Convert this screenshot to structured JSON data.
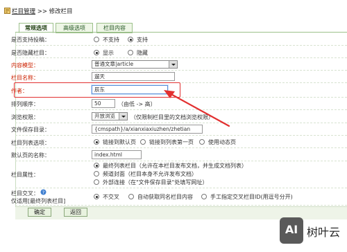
{
  "breadcrumb": {
    "link": "栏目管理",
    "separator": " >> ",
    "current": "修改栏目"
  },
  "tabs": [
    {
      "label": "常规选项"
    },
    {
      "label": "高级选项"
    },
    {
      "label": "栏目内容"
    }
  ],
  "form": {
    "support_submit": {
      "label": "是否支持投稿：",
      "options": [
        "不支持",
        "支持"
      ],
      "selected": "支持"
    },
    "hidden": {
      "label": "是否隐藏栏目：",
      "options": [
        "显示",
        "隐藏"
      ],
      "selected": "显示"
    },
    "content_model": {
      "label": "内容模型：",
      "value": "普通文章|article"
    },
    "column_name": {
      "label": "栏目名称：",
      "value": "遛天"
    },
    "author": {
      "label": "作者：",
      "value": "辰东"
    },
    "sort_order": {
      "label": "排列顺序：",
      "value": "50",
      "hint": "（由低 -> 高）"
    },
    "browse_permission": {
      "label": "浏览权限：",
      "value": "开放浏览",
      "hint": "（仅限制栏目里的文档浏览权限）"
    },
    "save_dir": {
      "label": "文件保存目录：",
      "value": "{cmspath}/a/xianxiaxiuzhen/zhetian"
    },
    "list_option": {
      "label": "栏目列表选项：",
      "options": [
        "链接到默认页",
        "链接到列表第一页",
        "使用动态页"
      ],
      "selected": "链接到默认页"
    },
    "default_page": {
      "label": "默认页的名称：",
      "value": "index.html"
    },
    "attribute": {
      "label": "栏目属性：",
      "options": [
        "最终列表栏目（允许在本栏目发布文档，并生成文档列表）",
        "频道封面（栏目本身不允许发布文档）",
        "外部连接（在\"文件保存目录\"处填写网址）"
      ],
      "selected": "最终列表栏目（允许在本栏目发布文档，并生成文档列表）"
    },
    "cross": {
      "label_line1": "栏目交叉：",
      "label_line2": "仅适用[最终列表栏目]",
      "options": [
        "不交叉",
        "自动获取同名栏目内容",
        "手工指定交叉栏目ID(用逗号分开)"
      ],
      "selected": "不交叉"
    }
  },
  "buttons": {
    "confirm": "确定",
    "back": "返回"
  },
  "watermark": {
    "logo": "AI",
    "text": "树叶云"
  },
  "colors": {
    "tab_border": "#9cc08a",
    "highlight_red": "#e23030",
    "required_label": "#cc2200"
  }
}
